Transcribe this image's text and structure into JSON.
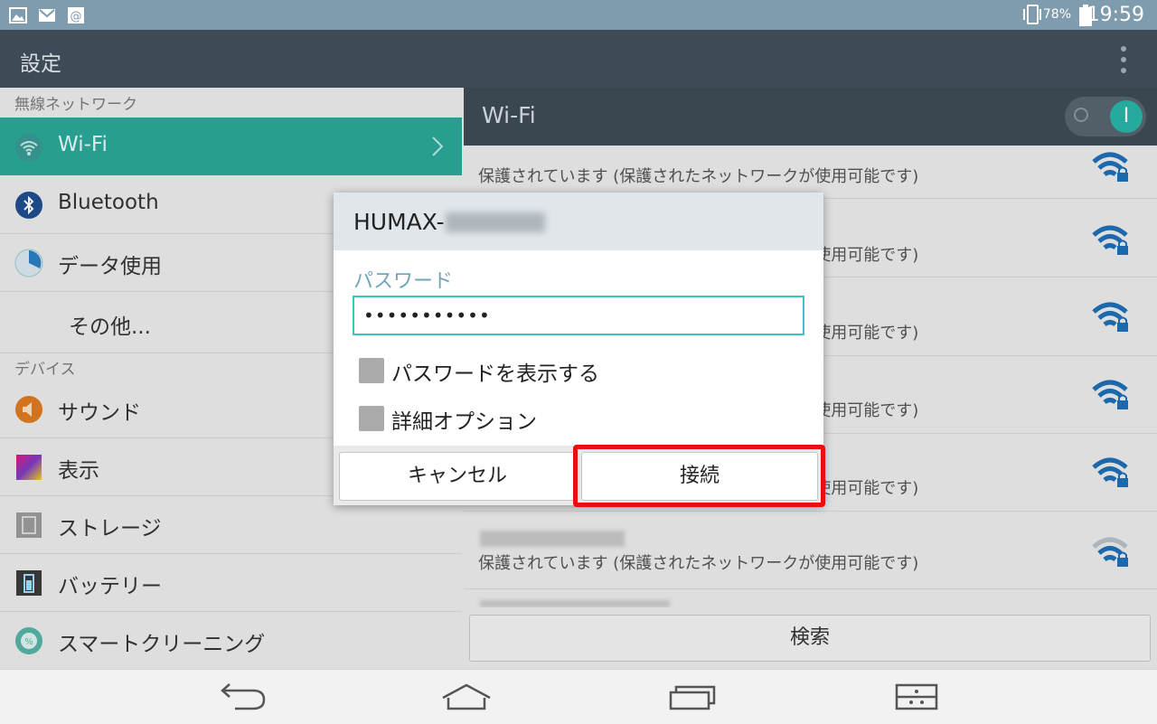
{
  "status": {
    "battery_pct": "78%",
    "time": "19:59"
  },
  "appbar": {
    "title": "設定"
  },
  "sidebar": {
    "section_wireless": "無線ネットワーク",
    "section_device": "デバイス",
    "items": [
      {
        "label": "Wi-Fi"
      },
      {
        "label": "Bluetooth"
      },
      {
        "label": "データ使用"
      },
      {
        "label": "その他..."
      },
      {
        "label": "サウンド"
      },
      {
        "label": "表示"
      },
      {
        "label": "ストレージ"
      },
      {
        "label": "バッテリー"
      },
      {
        "label": "スマートクリーニング"
      }
    ]
  },
  "wifi_panel": {
    "title": "Wi-Fi",
    "toggle_on_label": "I",
    "network_desc": "保護されています (保護されたネットワークが使用可能です)",
    "scan_label": "検索"
  },
  "dialog": {
    "title": "HUMAX-",
    "password_label": "パスワード",
    "password_value": "•••••••••••",
    "show_password_label": "パスワードを表示する",
    "advanced_options_label": "詳細オプション",
    "cancel_label": "キャンセル",
    "connect_label": "接続"
  },
  "colors": {
    "accent": "#2aa89a",
    "highlight": "#ee0d0d"
  }
}
